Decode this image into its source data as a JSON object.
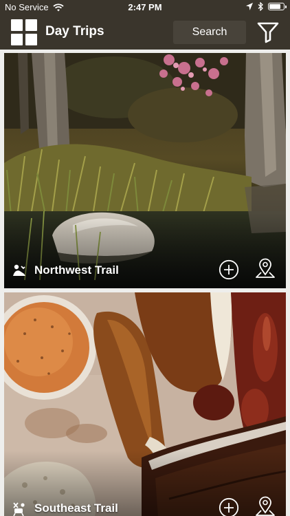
{
  "status_bar": {
    "carrier": "No Service",
    "time": "2:47 PM",
    "wifi_icon": "wifi-icon",
    "location_icon": "location-arrow-icon",
    "bluetooth_icon": "bluetooth-icon",
    "battery_level": 0.8
  },
  "nav": {
    "menu_icon": "grid-menu-icon",
    "title": "Day Trips",
    "search_label": "Search",
    "filter_icon": "filter-funnel-icon"
  },
  "trails": [
    {
      "name": "Northwest Trail",
      "icon": "hiker-trail-icon",
      "photo": "creek-cypress-trees-photo",
      "add_icon": "add-circle-icon",
      "map_icon": "map-pin-icon"
    },
    {
      "name": "Southeast Trail",
      "icon": "bbq-trail-icon",
      "photo": "barbecue-platter-photo",
      "add_icon": "add-circle-icon",
      "map_icon": "map-pin-icon"
    }
  ],
  "colors": {
    "bar_background": "#3a352c",
    "search_background": "#48433a",
    "feed_background": "#eeeeec",
    "text_light": "#ffffff"
  }
}
